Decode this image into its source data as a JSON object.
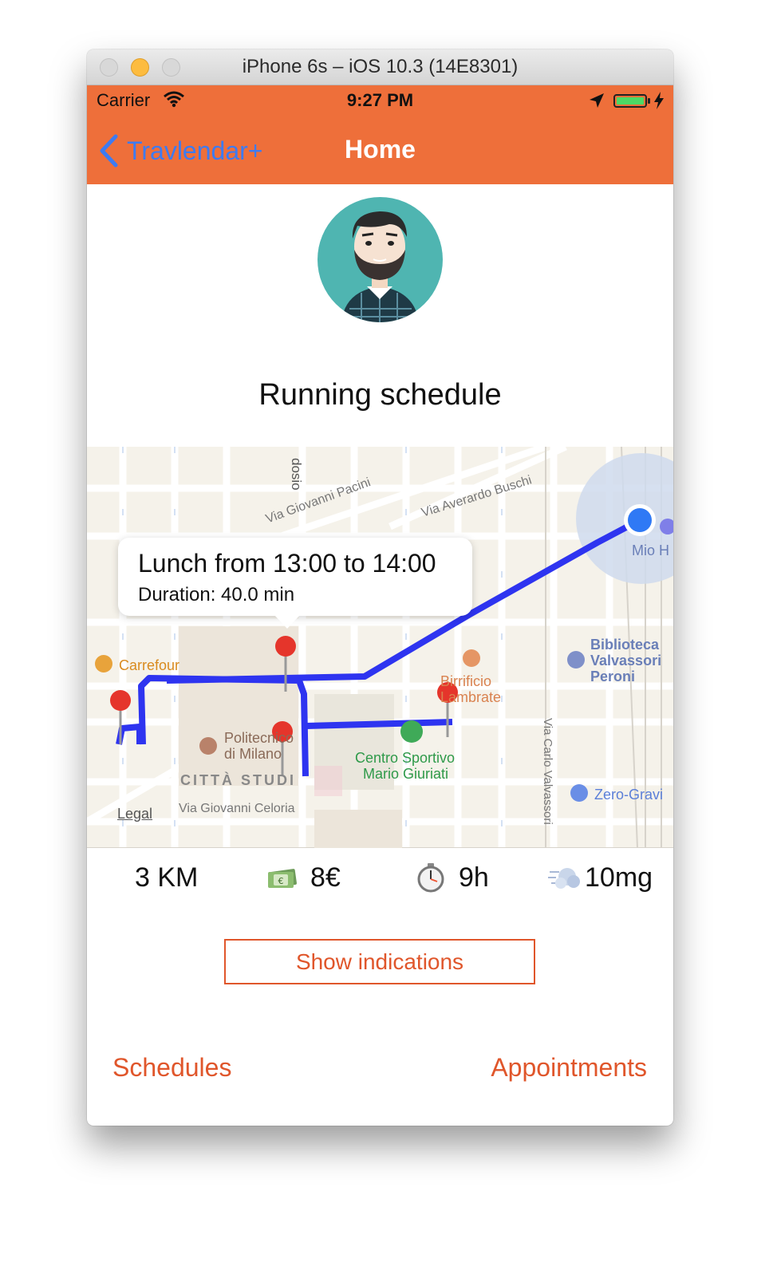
{
  "window": {
    "title": "iPhone 6s – iOS 10.3 (14E8301)"
  },
  "status_bar": {
    "carrier": "Carrier",
    "time": "9:27 PM"
  },
  "nav": {
    "back_label": "Travlendar+",
    "title": "Home"
  },
  "main": {
    "heading": "Running schedule"
  },
  "map": {
    "callout": {
      "title": "Lunch from 13:00 to 14:00",
      "subtitle": "Duration: 40.0 min"
    },
    "labels": {
      "street1": "Via Giovanni Pacini",
      "street2": "Via Averardo Buschi",
      "street3": "dosio",
      "street4": "Via Giovanni Celoria",
      "street5": "Via Carlo Valvassori",
      "place1": "Carrefour",
      "place2": "Politecnico",
      "place2b": "di Milano",
      "place3": "CITTÀ STUDI",
      "place4": "Birrificio",
      "place4b": "Lambrate",
      "place5": "Centro Sportivo",
      "place5b": "Mario Giuriati",
      "place6": "Biblioteca",
      "place6b": "Valvassori",
      "place6c": "Peroni",
      "place7": "Zero-Gravi",
      "place8": "Mio H"
    },
    "legal": "Legal"
  },
  "stats": {
    "distance": "3 KM",
    "cost": "8€",
    "time": "9h",
    "pollution": "10mg"
  },
  "icons": {
    "cost": "money-icon",
    "time": "stopwatch-icon",
    "pollution": "dash-cloud-icon"
  },
  "actions": {
    "show_indications": "Show indications"
  },
  "tabs": {
    "left": "Schedules",
    "right": "Appointments"
  },
  "colors": {
    "accent": "#ee6f3a",
    "link": "#e0562b",
    "back": "#3d7bf2",
    "route": "#2e34f0"
  }
}
